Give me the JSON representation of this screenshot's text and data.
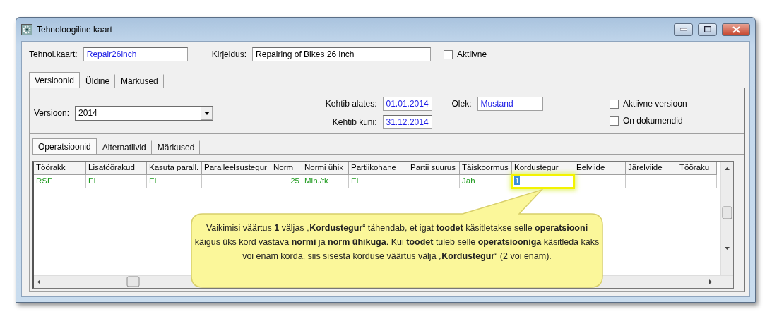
{
  "window": {
    "title": "Tehnoloogiline kaart"
  },
  "header": {
    "fields": [
      {
        "label": "Tehnol.kaart:",
        "value": "Repair26inch",
        "accent": true
      },
      {
        "label": "Kirjeldus:",
        "value": "Repairing of Bikes 26 inch",
        "accent": false
      }
    ],
    "checkbox": {
      "label": "Aktiivne",
      "checked": false
    }
  },
  "tabs": [
    {
      "label": "Versioonid",
      "selected": true
    },
    {
      "label": "Üldine",
      "selected": false
    },
    {
      "label": "Märkused",
      "selected": false
    }
  ],
  "version": {
    "label": "Versioon:",
    "value": "2014",
    "dates": [
      {
        "label": "Kehtib alates:",
        "value": "01.01.2014"
      },
      {
        "label": "Kehtib kuni:",
        "value": "31.12.2014"
      }
    ],
    "status": {
      "label": "Olek:",
      "value": "Mustand"
    },
    "checkboxes": [
      {
        "label": "Aktiivne versioon",
        "checked": false
      },
      {
        "label": "On dokumendid",
        "checked": false
      }
    ]
  },
  "sub_tabs": [
    {
      "label": "Operatsioonid",
      "selected": true
    },
    {
      "label": "Alternatiivid",
      "selected": false
    },
    {
      "label": "Märkused",
      "selected": false
    }
  ],
  "table": {
    "columns": [
      {
        "label": "Töörakk",
        "kind": "text"
      },
      {
        "label": "Lisatöörakud",
        "kind": "text"
      },
      {
        "label": "Kasuta parall.",
        "kind": "text"
      },
      {
        "label": "Paralleelsustegur",
        "kind": "text"
      },
      {
        "label": "Norm",
        "kind": "number"
      },
      {
        "label": "Normi ühik",
        "kind": "text"
      },
      {
        "label": "Partiikohane",
        "kind": "text"
      },
      {
        "label": "Partii suurus",
        "kind": "text"
      },
      {
        "label": "Täiskoormus",
        "kind": "text"
      },
      {
        "label": "Kordustegur",
        "kind": "text"
      },
      {
        "label": "Eelviide",
        "kind": "text"
      },
      {
        "label": "Järelviide",
        "kind": "text"
      },
      {
        "label": "Tööraku",
        "kind": "text"
      }
    ],
    "rows": [
      {
        "cells": [
          {
            "text": "RSF",
            "selected": false
          },
          {
            "text": "Ei",
            "selected": false
          },
          {
            "text": "Ei",
            "selected": false
          },
          {
            "selected": false
          },
          {
            "text": "25",
            "selected": false
          },
          {
            "text": "Min./tk",
            "selected": false
          },
          {
            "text": "Ei",
            "selected": false
          },
          {
            "selected": false
          },
          {
            "text": "Jah",
            "selected": false
          },
          {
            "text": "1",
            "selected": true
          },
          {
            "selected": false
          },
          {
            "selected": false
          },
          {
            "selected": false
          }
        ]
      }
    ]
  },
  "callout": {
    "text": "Vaikimisi väärtus **1** väljas „**Kordustegur**“ tähendab, et igat **toodet** käsitletakse selle **operatsiooni** käigus üks kord vastava **normi** ja **norm ühikuga**. Kui **toodet** tuleb selle **operatsiooniga** käsitleda kaks või enam korda, siis sisesta korduse väärtus välja „**Kordustegur**“ (2 või enam)."
  }
}
